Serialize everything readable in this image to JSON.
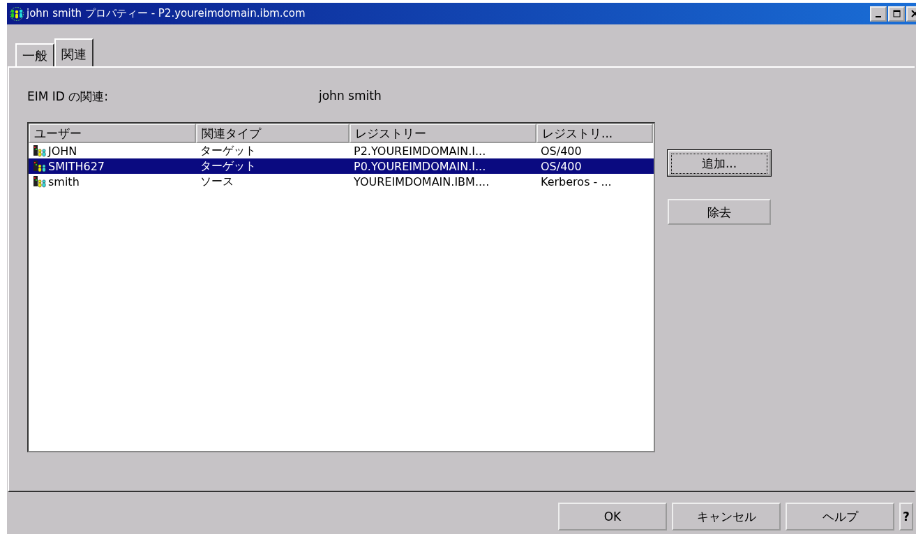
{
  "window": {
    "title": "john smith プロパティー - P2.youreimdomain.ibm.com"
  },
  "tabs": [
    {
      "label": "一般",
      "selected": false
    },
    {
      "label": "関連",
      "selected": true
    }
  ],
  "eim_id": {
    "label": "EIM ID の関連:",
    "value": "john smith"
  },
  "table": {
    "columns": [
      "ユーザー",
      "関連タイプ",
      "レジストリー",
      "レジストリ..."
    ],
    "rows": [
      {
        "cells": [
          "JOHN",
          "ターゲット",
          "P2.YOUREIMDOMAIN.I...",
          "OS/400"
        ],
        "selected": false
      },
      {
        "cells": [
          "SMITH627",
          "ターゲット",
          "P0.YOUREIMDOMAIN.I...",
          "OS/400"
        ],
        "selected": true
      },
      {
        "cells": [
          "smith",
          "ソース",
          "YOUREIMDOMAIN.IBM....",
          "Kerberos - ..."
        ],
        "selected": false
      }
    ]
  },
  "side_buttons": [
    {
      "label": "追加...",
      "focused": true
    },
    {
      "label": "除去",
      "focused": false
    }
  ],
  "buttons": [
    "OK",
    "キャンセル",
    "ヘルプ",
    "?"
  ]
}
